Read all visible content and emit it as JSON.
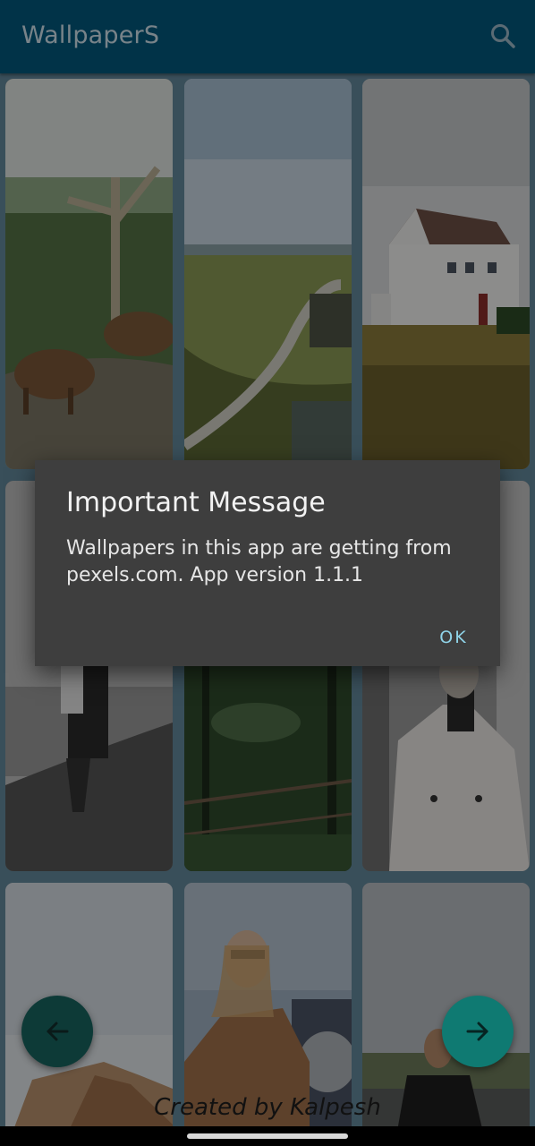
{
  "app_bar": {
    "title": "WallpaperS",
    "search_icon": "search-icon",
    "background": "#02587d"
  },
  "wallpapers": [
    {
      "subject": "animals-on-hill"
    },
    {
      "subject": "winding-path-coast"
    },
    {
      "subject": "white-house-field"
    },
    {
      "subject": "person-on-shore"
    },
    {
      "subject": "forest-fence"
    },
    {
      "subject": "person-in-trench-coat"
    },
    {
      "subject": "rocks-sky"
    },
    {
      "subject": "woman-sunglasses"
    },
    {
      "subject": "woman-on-road"
    }
  ],
  "footer": {
    "credit": "Created by Kalpesh"
  },
  "navigation": {
    "prev_icon": "arrow-left-icon",
    "next_icon": "arrow-right-icon"
  },
  "dialog": {
    "title": "Important Message",
    "message": "Wallpapers in this app are getting from pexels.com. App version 1.1.1",
    "ok_label": "OK"
  },
  "colors": {
    "accent": "#0f7a72",
    "dialog_background": "#3e3e3e",
    "dialog_button": "#8fd3e8"
  }
}
